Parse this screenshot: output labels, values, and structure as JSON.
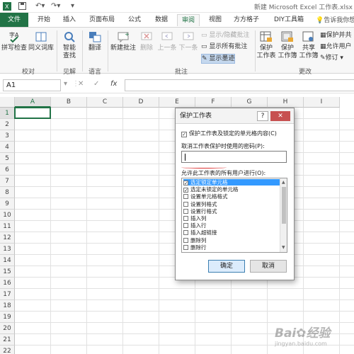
{
  "titlebar": {
    "window_title": "新建 Microsoft Excel 工作表.xlsx"
  },
  "ribbon_tabs": {
    "file": "文件",
    "tabs": [
      "开始",
      "插入",
      "页面布局",
      "公式",
      "数据",
      "审阅",
      "视图",
      "方方格子",
      "DIY工具箱"
    ],
    "active_tab": "审阅",
    "tell_me": "告诉我你想"
  },
  "ribbon": {
    "proofing": {
      "spell_check": "拼写检查",
      "thesaurus": "同义词库",
      "label": "校对"
    },
    "insights": {
      "smart_lookup_1": "智能",
      "smart_lookup_2": "查找",
      "label": "见解"
    },
    "language": {
      "translate": "翻译",
      "label": "语言"
    },
    "comments": {
      "new_comment": "新建批注",
      "delete": "删除",
      "previous": "上一条",
      "next": "下一条",
      "show_hide": "显示/隐藏批注",
      "show_all": "显示所有批注",
      "show_ink": "显示墨迹",
      "label": "批注"
    },
    "changes": {
      "protect_sheet_1": "保护",
      "protect_sheet_2": "工作表",
      "protect_workbook_1": "保护",
      "protect_workbook_2": "工作簿",
      "share_workbook_1": "共享",
      "share_workbook_2": "工作簿",
      "protect_and_share": "保护并共",
      "allow_edit": "允许用户",
      "track_changes": "修订",
      "label": "更改"
    }
  },
  "formula_bar": {
    "name_box": "A1",
    "cancel": "✕",
    "enter": "✓",
    "fx": "fx",
    "value": ""
  },
  "sheet": {
    "columns": [
      "A",
      "B",
      "C",
      "D",
      "E",
      "F",
      "G",
      "H",
      "I"
    ],
    "rows": [
      "1",
      "2",
      "3",
      "4",
      "5",
      "6",
      "7",
      "8",
      "9",
      "10",
      "11",
      "12",
      "13",
      "14",
      "15",
      "16",
      "17",
      "18",
      "19",
      "20",
      "21",
      "22"
    ],
    "active_cell": "A1"
  },
  "dialog": {
    "title": "保护工作表",
    "help": "?",
    "close": "✕",
    "protect_checkbox": "保护工作表及锁定的单元格内容(C)",
    "protect_checked": true,
    "password_label": "取消工作表保护时使用的密码(P):",
    "password_value": "",
    "allow_label": "允许此工作表的所有用户进行(O):",
    "permissions": [
      {
        "label": "选定锁定单元格",
        "checked": true
      },
      {
        "label": "选定未锁定的单元格",
        "checked": true
      },
      {
        "label": "设置单元格格式",
        "checked": false
      },
      {
        "label": "设置列格式",
        "checked": false
      },
      {
        "label": "设置行格式",
        "checked": false
      },
      {
        "label": "插入列",
        "checked": false
      },
      {
        "label": "插入行",
        "checked": false
      },
      {
        "label": "插入超链接",
        "checked": false
      },
      {
        "label": "删除列",
        "checked": false
      },
      {
        "label": "删除行",
        "checked": false
      }
    ],
    "ok": "确定",
    "cancel": "取消"
  },
  "watermark": {
    "brand": "Bai",
    "brand2": "经验",
    "url": "jingyan.baidu.com"
  },
  "colors": {
    "excel_green": "#217346",
    "selection_blue": "#3399ff",
    "close_red": "#c75050"
  }
}
